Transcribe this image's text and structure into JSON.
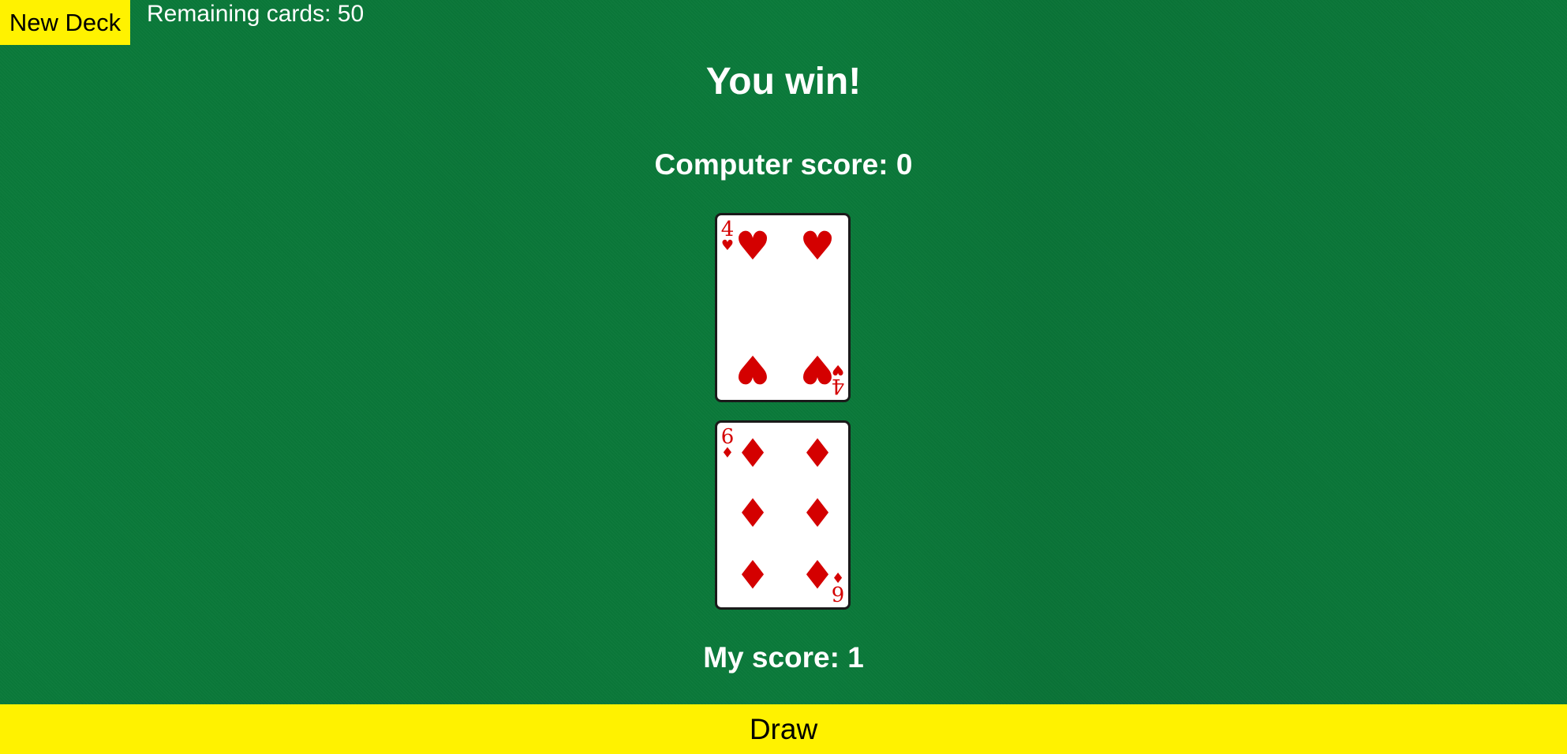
{
  "toolbar": {
    "new_deck_label": "New Deck",
    "remaining_text": "Remaining cards: 50"
  },
  "status": {
    "result_text": "You win!"
  },
  "scores": {
    "computer_text": "Computer score: 0",
    "player_text": "My score: 1"
  },
  "cards": {
    "computer": {
      "rank": "4",
      "suit": "hearts",
      "suit_symbol": "♥",
      "color": "#d40000"
    },
    "player": {
      "rank": "6",
      "suit": "diamonds",
      "suit_symbol": "♦",
      "color": "#d40000"
    }
  },
  "actions": {
    "draw_label": "Draw"
  },
  "colors": {
    "felt": "#0a7a3a",
    "button": "#fff200",
    "card_red": "#d40000"
  }
}
